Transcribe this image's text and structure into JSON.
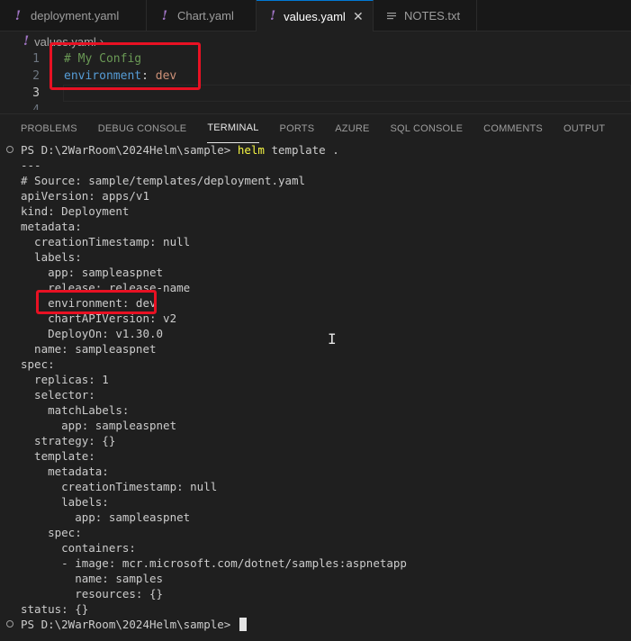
{
  "tabs": [
    {
      "label": "deployment.yaml",
      "icon": "yaml-exclamation-icon",
      "active": false
    },
    {
      "label": "Chart.yaml",
      "icon": "yaml-exclamation-icon",
      "active": false
    },
    {
      "label": "values.yaml",
      "icon": "yaml-exclamation-icon",
      "active": true
    },
    {
      "label": "NOTES.txt",
      "icon": "text-lines-icon",
      "active": false
    }
  ],
  "breadcrumb": {
    "file": "values.yaml",
    "chevron": "›"
  },
  "editor": {
    "line_numbers": [
      "1",
      "2",
      "3",
      "4"
    ],
    "line1_comment": "# My Config",
    "line2_key": "environment",
    "line2_colon": ": ",
    "line2_value": "dev"
  },
  "panel_tabs": [
    "PROBLEMS",
    "DEBUG CONSOLE",
    "TERMINAL",
    "PORTS",
    "AZURE",
    "SQL CONSOLE",
    "COMMENTS",
    "OUTPUT"
  ],
  "terminal": {
    "prompt": "PS D:\\2WarRoom\\2024Helm\\sample> ",
    "command": "helm",
    "command_args": " template .",
    "lines": [
      "---",
      "# Source: sample/templates/deployment.yaml",
      "apiVersion: apps/v1",
      "kind: Deployment",
      "metadata:",
      "  creationTimestamp: null",
      "  labels:",
      "    app: sampleaspnet",
      "    release: release-name",
      "    environment: dev",
      "    chartAPIVersion: v2",
      "    DeployOn: v1.30.0",
      "  name: sampleaspnet",
      "spec:",
      "  replicas: 1",
      "  selector:",
      "    matchLabels:",
      "      app: sampleaspnet",
      "  strategy: {}",
      "  template:",
      "    metadata:",
      "      creationTimestamp: null",
      "      labels:",
      "        app: sampleaspnet",
      "    spec:",
      "      containers:",
      "      - image: mcr.microsoft.com/dotnet/samples:aspnetapp",
      "        name: samples",
      "        resources: {}",
      "status: {}"
    ],
    "final_prompt": "PS D:\\2WarRoom\\2024Helm\\sample> "
  },
  "colors": {
    "highlight_box": "#e81123",
    "command": "#f5f543",
    "yaml_icon": "#a074c4"
  }
}
